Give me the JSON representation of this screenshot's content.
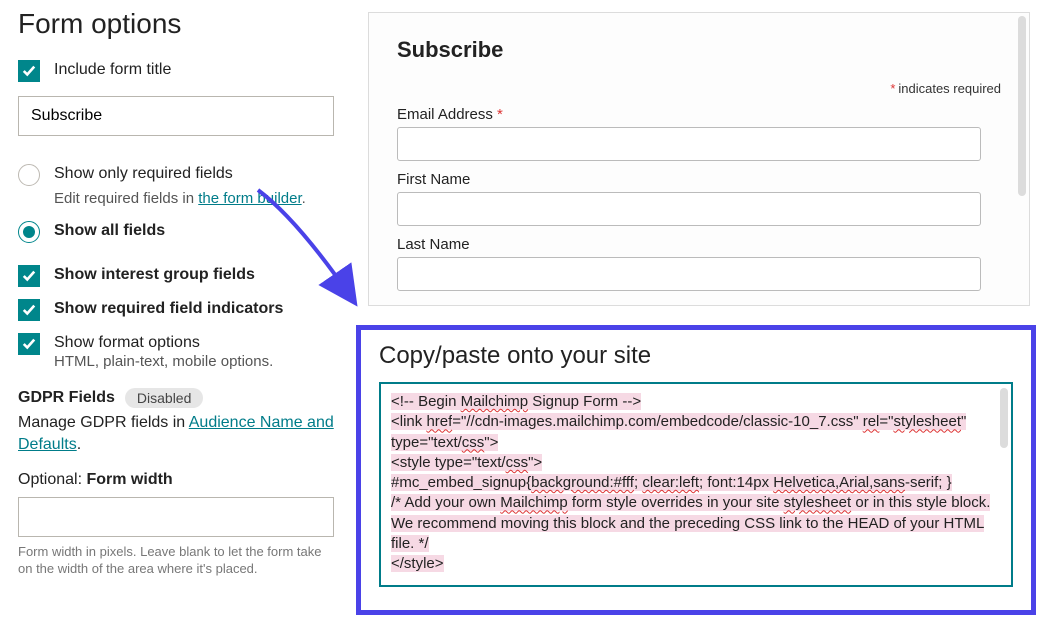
{
  "panel_title": "Form options",
  "include_title": {
    "label": "Include form title",
    "value": "Subscribe"
  },
  "field_mode": {
    "required_only_label": "Show only required fields",
    "required_only_sub_pre": "Edit required fields in ",
    "required_only_sub_link": "the form builder",
    "required_only_sub_post": ".",
    "show_all_label": "Show all fields"
  },
  "checkboxes": {
    "interest_label": "Show interest group fields",
    "required_ind_label": "Show required field indicators",
    "format_label": "Show format options",
    "format_sub": "HTML, plain-text, mobile options."
  },
  "gdpr": {
    "heading": "GDPR Fields",
    "badge": "Disabled",
    "text_pre": "Manage GDPR fields in ",
    "text_link": "Audience Name and Defaults",
    "text_post": "."
  },
  "form_width": {
    "label_pre": "Optional: ",
    "label_bold": "Form width",
    "hint": "Form width in pixels. Leave blank to let the form take on the width of the area where it's placed."
  },
  "preview": {
    "title": "Subscribe",
    "required_note": "indicates required",
    "email_label": "Email Address",
    "first_label": "First Name",
    "last_label": "Last Name"
  },
  "code": {
    "title": "Copy/paste onto your site",
    "l1_a": "<!-- Begin ",
    "l1_b": "Mailchimp",
    "l1_c": " Signup Form -->",
    "l2_a": "<link ",
    "l2_b": "href",
    "l2_c": "=\"//cdn-images.mailchimp.com/embedcode/classic-10_7.css\" ",
    "l2_d": "rel",
    "l2_e": "=\"",
    "l2_f": "stylesheet",
    "l2_g": "\" type=\"text/",
    "l2_h": "css",
    "l2_i": "\">",
    "l3_a": "<style type=\"text/",
    "l3_b": "css",
    "l3_c": "\">",
    "l4_a": "        #mc_embed_signup{",
    "l4_b": "background:#fff",
    "l4_c": "; ",
    "l4_d": "clear:left",
    "l4_e": "; font:14px ",
    "l4_f": "Helvetica,Arial,sans",
    "l4_g": "-serif; }",
    "l5": "        /* Add your own ",
    "l5_b": "Mailchimp",
    "l5_c": " form style overrides in your site ",
    "l5_d": "stylesheet",
    "l5_e": " or in this style block.",
    "l6": "           We recommend moving this block and the preceding CSS link to the HEAD of your HTML file. */",
    "l7": "</style>"
  }
}
